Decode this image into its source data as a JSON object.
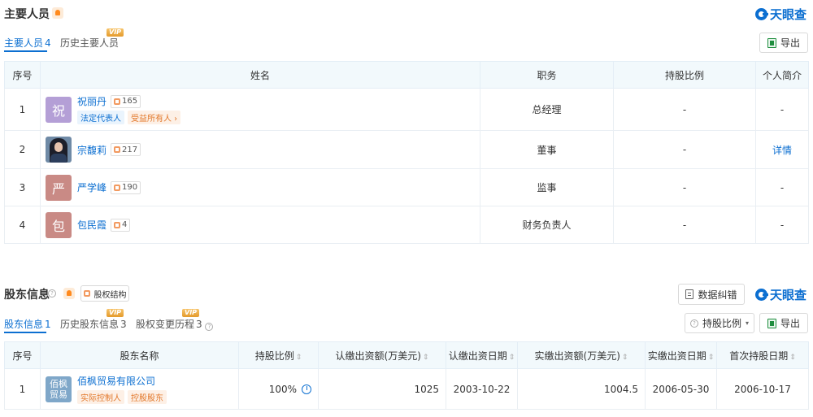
{
  "brand": "天眼查",
  "section1": {
    "title": "主要人员",
    "tabs": [
      {
        "label": "主要人员",
        "count": "4",
        "vip": ""
      },
      {
        "label": "历史主要人员",
        "count": "",
        "vip": "VIP"
      }
    ],
    "export_label": "导出",
    "headers": [
      "序号",
      "姓名",
      "职务",
      "持股比例",
      "个人简介"
    ],
    "rows": [
      {
        "no": "1",
        "avatar_char": "祝",
        "avatar_color": "#b49fd6",
        "name": "祝丽丹",
        "count": "165",
        "tags": [
          "法定代表人"
        ],
        "tags2": [
          "受益所有人"
        ],
        "position": "总经理",
        "share": "-",
        "profile": "-"
      },
      {
        "no": "2",
        "avatar_char": "",
        "avatar_color": "",
        "name": "宗馥莉",
        "count": "217",
        "tags": [],
        "tags2": [],
        "position": "董事",
        "share": "-",
        "profile": "详情"
      },
      {
        "no": "3",
        "avatar_char": "严",
        "avatar_color": "#c98a85",
        "name": "严学峰",
        "count": "190",
        "tags": [],
        "tags2": [],
        "position": "监事",
        "share": "-",
        "profile": "-"
      },
      {
        "no": "4",
        "avatar_char": "包",
        "avatar_color": "#c98a85",
        "name": "包民霞",
        "count": "4",
        "tags": [],
        "tags2": [],
        "position": "财务负责人",
        "share": "-",
        "profile": "-"
      }
    ]
  },
  "section2": {
    "title": "股东信息",
    "structure_label": "股权结构",
    "correction_label": "数据纠错",
    "tabs": [
      {
        "label": "股东信息",
        "count": "1",
        "vip": ""
      },
      {
        "label": "历史股东信息",
        "count": "3",
        "vip": "VIP"
      },
      {
        "label": "股权变更历程",
        "count": "3",
        "vip": "VIP"
      }
    ],
    "filter_label": "持股比例",
    "export_label": "导出",
    "headers": [
      "序号",
      "股东名称",
      "持股比例",
      "认缴出资额(万美元)",
      "认缴出资日期",
      "实缴出资额(万美元)",
      "实缴出资日期",
      "首次持股日期"
    ],
    "rows": [
      {
        "no": "1",
        "logo_text": "佰枫贸易",
        "name": "佰枫贸易有限公司",
        "tags": [
          "实际控制人",
          "控股股东"
        ],
        "share": "100%",
        "subscribed": "1025",
        "subscribed_date": "2003-10-22",
        "paid": "1004.5",
        "paid_date": "2006-05-30",
        "first_date": "2006-10-17"
      }
    ]
  }
}
